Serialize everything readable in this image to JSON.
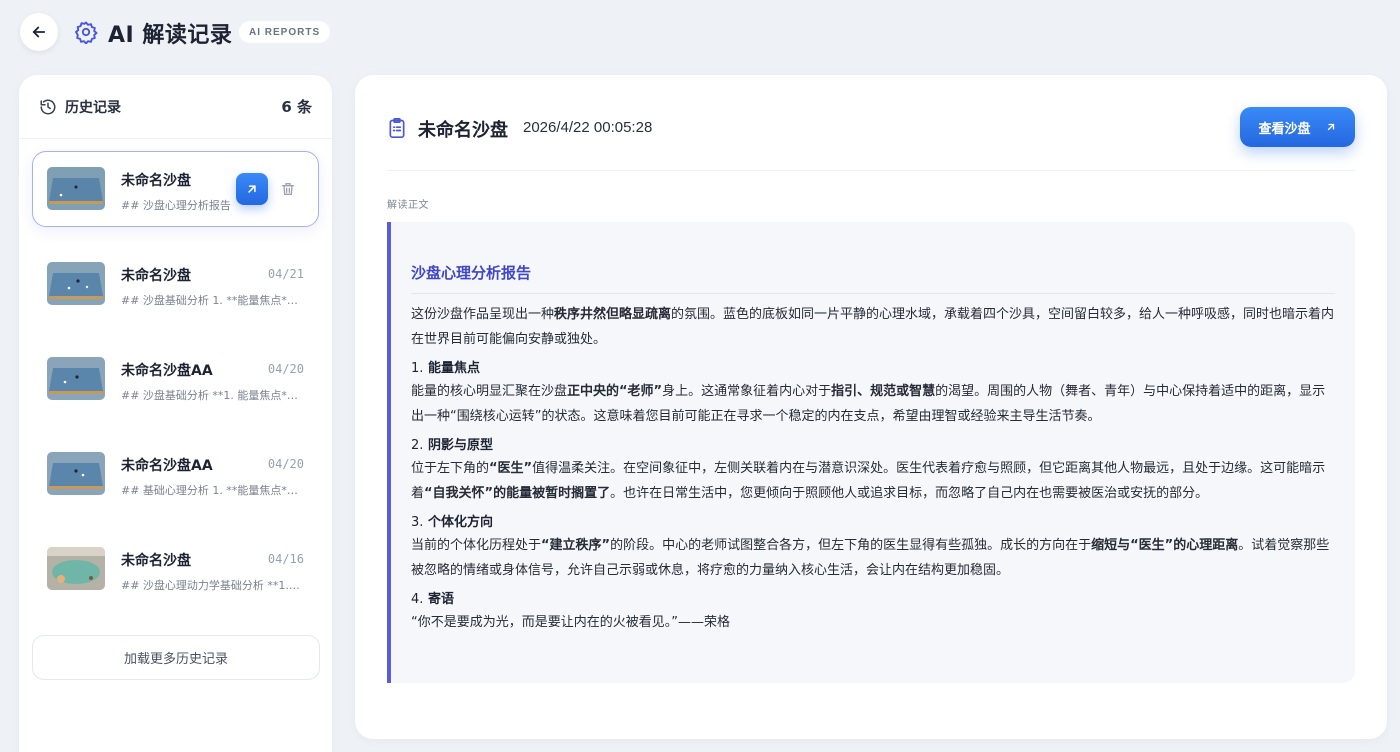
{
  "header": {
    "title": "AI 解读记录",
    "badge": "AI REPORTS"
  },
  "sidebar": {
    "title": "历史记录",
    "count": "6 条",
    "items": [
      {
        "title": "未命名沙盘",
        "date": "",
        "snippet": "## 沙盘心理分析报告",
        "active": true
      },
      {
        "title": "未命名沙盘",
        "date": "04/21",
        "snippet": "## 沙盘基础分析 1. **能量焦点**..."
      },
      {
        "title": "未命名沙盘AA",
        "date": "04/20",
        "snippet": "## 沙盘基础分析 **1. 能量焦点**..."
      },
      {
        "title": "未命名沙盘AA",
        "date": "04/20",
        "snippet": "## 基础心理分析 1. **能量焦点**..."
      },
      {
        "title": "未命名沙盘",
        "date": "04/16",
        "snippet": "## 沙盘心理动力学基础分析 **1. ..."
      }
    ],
    "load_more": "加载更多历史记录"
  },
  "main": {
    "title": "未命名沙盘",
    "timestamp": "2026/4/22 00:05:28",
    "view_button": "查看沙盘",
    "section_label": "解读正文",
    "report": {
      "heading": "沙盘心理分析报告",
      "intro": [
        "这份沙盘作品呈现出一种",
        "秩序井然但略显疏离",
        "的氛围。蓝色的底板如同一片平静的心理水域，承载着四个沙具，空间留白较多，给人一种呼吸感，同时也暗示着内在世界目前可能偏向安静或独处。"
      ],
      "sections": [
        {
          "num": "1.",
          "title": "能量焦点",
          "parts": [
            "能量的核心明显汇聚在沙盘",
            "正中央的“老师”",
            "身上。这通常象征着内心对于",
            "指引、规范或智慧",
            "的渴望。周围的人物（舞者、青年）与中心保持着适中的距离，显示出一种“围绕核心运转”的状态。这意味着您目前可能正在寻求一个稳定的内在支点，希望由理智或经验来主导生活节奏。"
          ]
        },
        {
          "num": "2.",
          "title": "阴影与原型",
          "parts": [
            "位于左下角的",
            "“医生”",
            "值得温柔关注。在空间象征中，左侧关联着内在与潜意识深处。医生代表着疗愈与照顾，但它距离其他人物最远，且处于边缘。这可能暗示着",
            "“自我关怀”的能量被暂时搁置了",
            "。也许在日常生活中，您更倾向于照顾他人或追求目标，而忽略了自己内在也需要被医治或安抚的部分。"
          ]
        },
        {
          "num": "3.",
          "title": "个体化方向",
          "parts": [
            "当前的个体化历程处于",
            "“建立秩序”",
            "的阶段。中心的老师试图整合各方，但左下角的医生显得有些孤独。成长的方向在于",
            "缩短与“医生”的心理距离",
            "。试着觉察那些被忽略的情绪或身体信号，允许自己示弱或休息，将疗愈的力量纳入核心生活，会让内在结构更加稳固。"
          ]
        },
        {
          "num": "4.",
          "title": "寄语",
          "parts": [
            "“你不是要成为光，而是要让内在的火被看见。”——荣格"
          ]
        }
      ]
    }
  },
  "colors": {
    "accent_blue": "#2a74e8",
    "report_heading": "#4047c8",
    "report_border": "#5b5be0"
  }
}
